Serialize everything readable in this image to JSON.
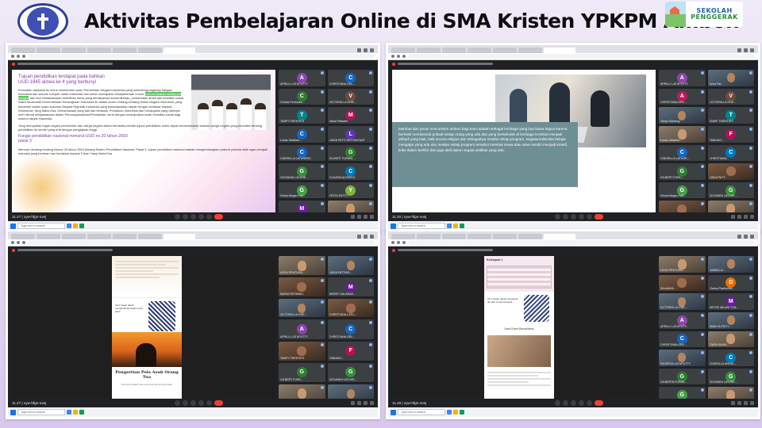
{
  "header": {
    "title": "Aktivitas Pembelajaran Online di SMA Kristen YPKPM Ambon",
    "right_logo_line1": "SEKOLAH",
    "right_logo_line2": "PENGGERAK"
  },
  "colors": {
    "page_background": "#e6dcf2",
    "meet_dark": "#202124",
    "end_call_red": "#ea4335",
    "slide_accent_purple": "#7b3ea6",
    "teal_textbox": "#6e8f94"
  },
  "screenshots": [
    {
      "meeting_time": "11.27 | xyw-hfgn-ovej",
      "taskbar_search": "Type here to search",
      "slide": {
        "title": "Tujuan pendidikan terdapat pada bahkan UUD 1945 alinea ke 4 yang berbunyi",
        "paragraph1": "Kemudian daripada itu untuk membentuk suatu Pemerintah Negara Indonesia yang melindungi segenap bangsa Indonesia dan seluruh tumpah darah Indonesia dan untuk memajukan kesejahteraan umum, mencerdaskan kehidupan bangsa, dan ikut melaksanakan ketertiban dunia yang berdasarkan kemerdekaan, perdamaian abadi dan keadilan sosial, maka disusunlah Kemerdekaan Kebangsaan Indonesia itu dalam suatu Undang-Undang Dasar Negara Indonesia, yang terbentuk dalam suatu susunan Negara Republik Indonesia yang berkedaulatan rakyat dengan berdasar kepada Ketuhanan Yang Maha Esa, Kemanusiaan yang adil dan beradab, Persatuan Indonesia dan Kerakyatan yang dipimpin oleh hikmat kebijaksanaan dalam Permusyawaratan/Perwakilan, serta dengan mewujudkan suatu Keadilan sosial bagi seluruh rakyat Indonesia.",
        "highlight": "mencerdaskan kehidupan bangsa",
        "paragraph2": "Yang merupakan tugas negara pemerintah dan warga negara dalam berusaha meraih tujuan pendidikan untuk dapat mencerdaskan sebuah warga negara yang berkaitan tentang pendidikan itu sendiri yang erat dengan pengajaran tinggi.",
        "subtitle": "Fungsi pendidikan nasional menurut UUD no 20 tahun 2003 pasal 3",
        "paragraph3": "Menurut Undang-Undang Nomor 20 tahun 2003 tentang Sistem Pendidikan Nasional, Pasal 3, tujuan pendidikan nasional adalah mengembangkan potensi peserta didik agar menjadi manusia yang beriman dan bertakwa kepada Tuhan Yang Maha Esa."
      },
      "participants": [
        {
          "initial": "A",
          "name": "APRILLI LATUPUTTY",
          "color": "#8e44ad"
        },
        {
          "initial": "C",
          "name": "CHRISTIANA ORL...",
          "color": "#1565c0"
        },
        {
          "initial": "C",
          "name": "Christa Pentuoka...",
          "color": "#2e7d32"
        },
        {
          "initial": "V",
          "name": "VICTORIA LA GHEI...",
          "color": "#6d4c41"
        },
        {
          "initial": "T",
          "name": "TAMPI TWENTIES",
          "color": "#00838f"
        },
        {
          "initial": "M",
          "name": "Maria Patiwael",
          "color": "#ad1457"
        },
        {
          "initial": "C",
          "name": "Lusas Oktafian...",
          "color": "#1565c0"
        },
        {
          "initial": "L",
          "name": "LINDA PATTI ANTYANYANT",
          "color": "#5e35b1"
        },
        {
          "initial": "C",
          "name": "CINDRILLA LATUHERU",
          "color": "#1565c0"
        },
        {
          "initial": "G",
          "name": "GILBERT FUPANL...",
          "color": "#2e7d32"
        },
        {
          "initial": "G",
          "name": "GIOVANNI LATUHE...",
          "color": "#388e3c"
        },
        {
          "initial": "C",
          "name": "CLAUDIA ALFARCO",
          "color": "#0277bd"
        },
        {
          "initial": "G",
          "name": "Gloria Megan Fati...",
          "color": "#43a047"
        },
        {
          "initial": "Y",
          "name": "YESTA PATTY...",
          "color": "#7cb342"
        },
        {
          "initial": "M",
          "name": "MARIA GUMY...",
          "color": "#6a1b9a"
        },
        {
          "initial": "",
          "name": "18 lainnya",
          "color": "#5f6368"
        }
      ]
    },
    {
      "meeting_time": "11.20 | xyw-hfgn-ovej",
      "taskbar_search": "Type here to search",
      "slide": {
        "body": "Manfaat dan peran sma kristen ambon bagi kami adalah sebagai lembaga yang luar biasa bagus karena berhasil membentuk pribadi setiap orang yang ada dan yang bersekolah di lembaga tersebut menjadi pribadi yang baik, baik secara religius dan sebagainya melalui setiap program, kegiatan/aktivitas belajar mengajar yang ada dan melalui setiap program tersebut membat siswa atau siswi sendiri menjadi kreatif, kritis dalam berfikir dan juga aktif dalam segala aktifitas yang ada."
      },
      "participants": [
        {
          "initial": "A",
          "name": "APRILLI LATUPUTTY",
          "color": "#8e44ad"
        },
        {
          "initial": "",
          "name": "Nova Pat...",
          "color": "#5f6368"
        },
        {
          "initial": "A",
          "name": "CHRISTIANA ORL...",
          "color": "#c2185b"
        },
        {
          "initial": "V",
          "name": "VICTORIA LA GHE...",
          "color": "#6d4c41"
        },
        {
          "initial": "",
          "name": "Tampi Ganteng",
          "color": "#5f6368"
        },
        {
          "initial": "T",
          "name": "TAMPI TWENTIES",
          "color": "#00838f"
        },
        {
          "initial": "",
          "name": "Lusas Oktafian...",
          "color": "#5f6368"
        },
        {
          "initial": "F",
          "name": "FABIANO...",
          "color": "#ad1457"
        },
        {
          "initial": "C",
          "name": "CINDRILLA LATUHE...",
          "color": "#1565c0"
        },
        {
          "initial": "C",
          "name": "CHRISTIANA...",
          "color": "#0277bd"
        },
        {
          "initial": "G",
          "name": "GILBERT FUPA...",
          "color": "#2e7d32"
        },
        {
          "initial": "",
          "name": "LINDA PATT...",
          "color": "#5f6368"
        },
        {
          "initial": "G",
          "name": "Gloria Megan Fati...",
          "color": "#43a047"
        },
        {
          "initial": "G",
          "name": "GIOVANNI LATUHE...",
          "color": "#388e3c"
        },
        {
          "initial": "",
          "name": "Linda Pattiasina...",
          "color": "#5f6368"
        },
        {
          "initial": "",
          "name": "17 lainnya",
          "color": "#5f6368"
        }
      ]
    },
    {
      "meeting_time": "11.27 | xyw-hfgn-ovej",
      "taskbar_search": "Type here to search",
      "slide": {
        "caption": "Pengertian Pola Asuh Orang Tua",
        "sub": "Pola asuh adalah cara orang tua membimbing anak.",
        "ill_text": "Inti 1 Suatu dasar mengenali diri dalam pola asuh.",
        "footer": "GUBELIS KIKIT MANAGE KELAS XI IPA 3"
      },
      "participants": [
        {
          "initial": "",
          "name": "LEON PENTURA...",
          "color": "#5f6368"
        },
        {
          "initial": "",
          "name": "LINDA PATTIAS...",
          "color": "#5f6368"
        },
        {
          "initial": "",
          "name": "MARIA PATIWAEL",
          "color": "#5f6368"
        },
        {
          "initial": "M",
          "name": "MERRY SALAMAK...",
          "color": "#6a1b9a"
        },
        {
          "initial": "",
          "name": "VICTORIA LA GHE...",
          "color": "#5f6368"
        },
        {
          "initial": "",
          "name": "CHRISTIANA LATU...",
          "color": "#5f6368"
        },
        {
          "initial": "A",
          "name": "APRILLI LATUPUTTY",
          "color": "#8e44ad"
        },
        {
          "initial": "C",
          "name": "CHRISTIANA ORL...",
          "color": "#1565c0"
        },
        {
          "initial": "",
          "name": "TAMPI TWENTIES",
          "color": "#5f6368"
        },
        {
          "initial": "F",
          "name": "FABIANO...",
          "color": "#ad1457"
        },
        {
          "initial": "G",
          "name": "GILBERT FUPA...",
          "color": "#2e7d32"
        },
        {
          "initial": "G",
          "name": "GIOVANNI LATUHE...",
          "color": "#388e3c"
        },
        {
          "initial": "",
          "name": "CINDRILLA LATU...",
          "color": "#5f6368"
        },
        {
          "initial": "",
          "name": "17 lainnya",
          "color": "#5f6368"
        }
      ]
    },
    {
      "meeting_time": "11.26 | xyw-hfgn-ovej",
      "taskbar_search": "Type here to search",
      "slide": {
        "kelompok": "Kelompok 1",
        "mid_text": "Hasil Karet Bersahabat",
        "ill_text": "Inti 1 Suatu dasar mengenali diri dan menerima anak.",
        "footer": "GUBELIS KIKIT MANAGE KELAS XI IPA 3"
      },
      "participants": [
        {
          "initial": "",
          "name": "LEON PENTURA...",
          "color": "#5f6368"
        },
        {
          "initial": "",
          "name": "DANIELLA...",
          "color": "#5f6368"
        },
        {
          "initial": "",
          "name": "SALAMAK...",
          "color": "#5f6368"
        },
        {
          "initial": "D",
          "name": "Clarisa Pardimiha...",
          "color": "#ef6c00"
        },
        {
          "initial": "",
          "name": "VICTORIA LA GHE...",
          "color": "#5f6368"
        },
        {
          "initial": "M",
          "name": "MEYSE MILANI TUN...",
          "color": "#6a1b9a"
        },
        {
          "initial": "A",
          "name": "APRILLI LATUPUTY...",
          "color": "#8e44ad"
        },
        {
          "initial": "",
          "name": "AMALYA PATTI...",
          "color": "#5f6368"
        },
        {
          "initial": "C",
          "name": "CHRISTIANA ORL...",
          "color": "#1565c0"
        },
        {
          "initial": "",
          "name": "TIARA SIAHA...",
          "color": "#5f6368"
        },
        {
          "initial": "",
          "name": "FAHREZA LATUPUTTY",
          "color": "#5f6368"
        },
        {
          "initial": "C",
          "name": "CINDRILLA ANGEL...",
          "color": "#0277bd"
        },
        {
          "initial": "G",
          "name": "GILBERTA FUPAN...",
          "color": "#2e7d32"
        },
        {
          "initial": "G",
          "name": "GIOVANNI LATUHE...",
          "color": "#388e3c"
        },
        {
          "initial": "G",
          "name": "Gloria Megan Fati...",
          "color": "#43a047"
        },
        {
          "initial": "",
          "name": "18 lainnya",
          "color": "#5f6368"
        }
      ]
    }
  ]
}
